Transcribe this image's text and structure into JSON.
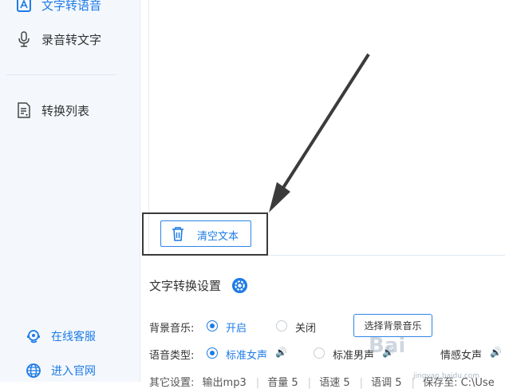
{
  "sidebar": {
    "items": [
      {
        "label": "文字转语音",
        "icon": "text-to-speech-icon",
        "active": true
      },
      {
        "label": "录音转文字",
        "icon": "microphone-icon",
        "active": false
      },
      {
        "label": "转换列表",
        "icon": "conversion-list-icon",
        "active": false
      }
    ],
    "links": [
      {
        "label": "在线客服",
        "icon": "customer-service-icon"
      },
      {
        "label": "进入官网",
        "icon": "globe-icon"
      }
    ]
  },
  "editor": {
    "clear_button_label": "清空文本"
  },
  "settings": {
    "title": "文字转换设置",
    "bg_music": {
      "label": "背景音乐:",
      "options": [
        "开启",
        "关闭"
      ],
      "selected": "开启",
      "select_button": "选择背景音乐"
    },
    "voice_type": {
      "label": "语音类型:",
      "options": [
        "标准女声",
        "标准男声",
        "情感女声"
      ],
      "selected": "标准女声"
    },
    "other": {
      "label": "其它设置:",
      "values": [
        "输出mp3",
        "音量 5",
        "语速 5",
        "语调 5",
        "保存至: C:\\Use"
      ]
    }
  },
  "watermark": {
    "text": "Bai",
    "sub": "jingyan.baidu.com"
  },
  "colors": {
    "accent": "#1e7be6",
    "sidebar_bg": "#f4f8fd",
    "highlight_border": "#3a3a3a"
  }
}
